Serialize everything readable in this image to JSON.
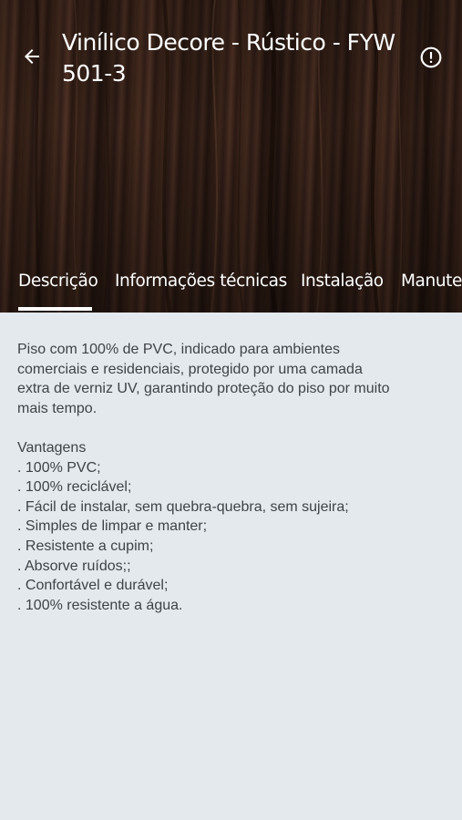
{
  "header": {
    "title": "Vinílico Decore - Rústico - FYW 501-3",
    "back_icon": "arrow-left-icon",
    "info_icon": "alert-circle-icon"
  },
  "tabs": [
    {
      "label": "Descrição",
      "selected": true
    },
    {
      "label": "Informações técnicas",
      "selected": false
    },
    {
      "label": "Instalação",
      "selected": false
    },
    {
      "label": "Manutenção",
      "selected": false
    }
  ],
  "content": {
    "description": [
      "Piso com 100% de PVC, indicado para ambientes",
      "comerciais e residenciais, protegido por uma camada",
      "extra de verniz UV, garantindo proteção do piso por muito",
      "mais tempo."
    ],
    "advantages_title": "Vantagens",
    "advantages": [
      ". 100% PVC;",
      ". 100% reciclável;",
      ". Fácil de instalar, sem quebra-quebra, sem sujeira;",
      ". Simples de limpar e manter;",
      ". Resistente a cupim;",
      ". Absorve ruídos;;",
      ". Confortável e durável;",
      ". 100% resistente a água."
    ]
  },
  "colors": {
    "content_bg": "#e3e9ed",
    "text": "#3f4346",
    "header_text": "#ffffff",
    "wood": "#3a241a"
  }
}
